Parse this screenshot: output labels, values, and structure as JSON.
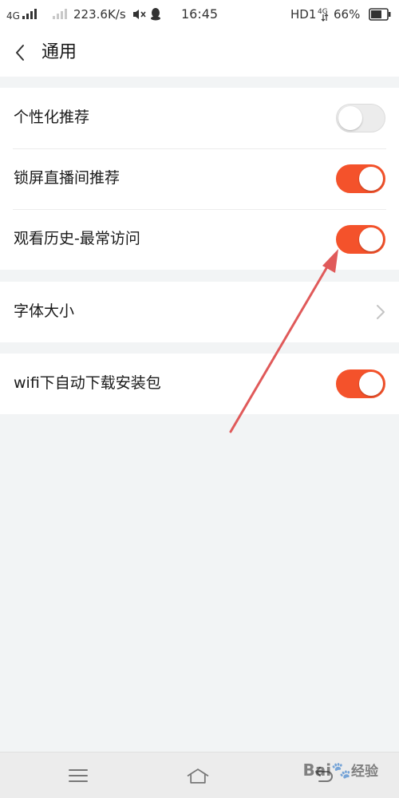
{
  "status_bar": {
    "network_left": "4G",
    "speed": "223.6K/s",
    "time": "16:45",
    "hd": "HD1",
    "network_right": "4G",
    "battery": "66%"
  },
  "header": {
    "title": "通用"
  },
  "settings": {
    "personalized_recommend": {
      "label": "个性化推荐",
      "enabled": false
    },
    "lockscreen_live_recommend": {
      "label": "锁屏直播间推荐",
      "enabled": true
    },
    "history_frequent": {
      "label": "观看历史-最常访问",
      "enabled": true
    },
    "font_size": {
      "label": "字体大小"
    },
    "wifi_auto_download": {
      "label": "wifi下自动下载安装包",
      "enabled": true
    }
  },
  "watermark": {
    "brand": "Bai",
    "brand_suffix": "经验"
  },
  "colors": {
    "accent": "#f4522b",
    "annotation_arrow": "#e05a5a",
    "background": "#f2f4f5"
  }
}
